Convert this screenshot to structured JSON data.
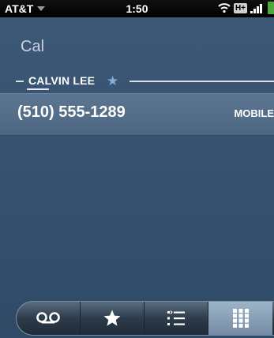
{
  "status_bar": {
    "carrier": "AT&T",
    "time": "1:50",
    "network": "H+",
    "colors": {
      "battery": "#4caa3c"
    }
  },
  "search": {
    "query": "Cal"
  },
  "contact": {
    "name": "CALVIN LEE",
    "favorite_icon": "star-icon",
    "phone": {
      "number": "(510) 555-1289",
      "type": "MOBILE"
    }
  },
  "tab_bar": {
    "tabs": [
      {
        "icon": "voicemail-icon",
        "active": false
      },
      {
        "icon": "star-icon",
        "active": false
      },
      {
        "icon": "call-log-icon",
        "active": false
      },
      {
        "icon": "dialpad-icon",
        "active": true
      }
    ]
  },
  "colors": {
    "background": "#3a5674",
    "highlight_row": "#5c7591",
    "accent_star": "#7faedc"
  }
}
